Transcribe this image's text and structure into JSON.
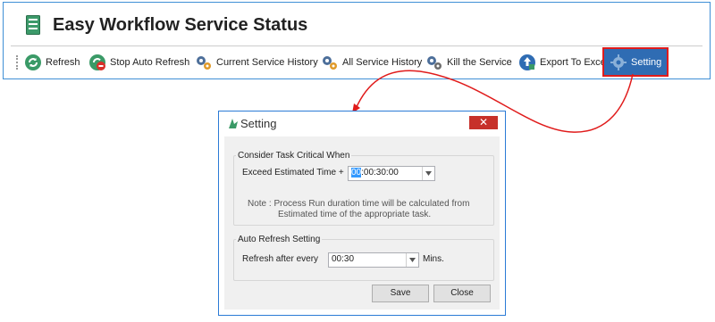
{
  "app": {
    "title": "Easy Workflow Service Status"
  },
  "toolbar": {
    "buttons": [
      {
        "label": "Refresh",
        "icon": "refresh-icon"
      },
      {
        "label": "Stop Auto Refresh",
        "icon": "stop-refresh-icon"
      },
      {
        "label": "Current Service History",
        "icon": "gears-icon"
      },
      {
        "label": "All Service History",
        "icon": "gears-icon"
      },
      {
        "label": "Kill the Service",
        "icon": "gears-icon"
      },
      {
        "label": "Export To Excel",
        "icon": "export-icon"
      },
      {
        "label": "Setting",
        "icon": "gear-icon"
      }
    ]
  },
  "dialog": {
    "title": "Setting",
    "close_label": "✕",
    "task_group": {
      "legend": "Consider Task Critical When",
      "label": "Exceed Estimated Time +",
      "value_highlight": "00",
      "value_rest": ":00:30:00",
      "note_line1": "Note : Process Run duration time will be calculated from",
      "note_line2": "Estimated time of the appropriate task."
    },
    "refresh_group": {
      "legend": "Auto Refresh Setting",
      "label": "Refresh after every",
      "value": "00:30",
      "unit": "Mins."
    },
    "save_label": "Save",
    "close_button_label": "Close"
  },
  "colors": {
    "accent": "#2f6cb3",
    "highlight_border": "#e01b1b",
    "close_red": "#c7312a",
    "dialog_border": "#2b7bd6"
  }
}
